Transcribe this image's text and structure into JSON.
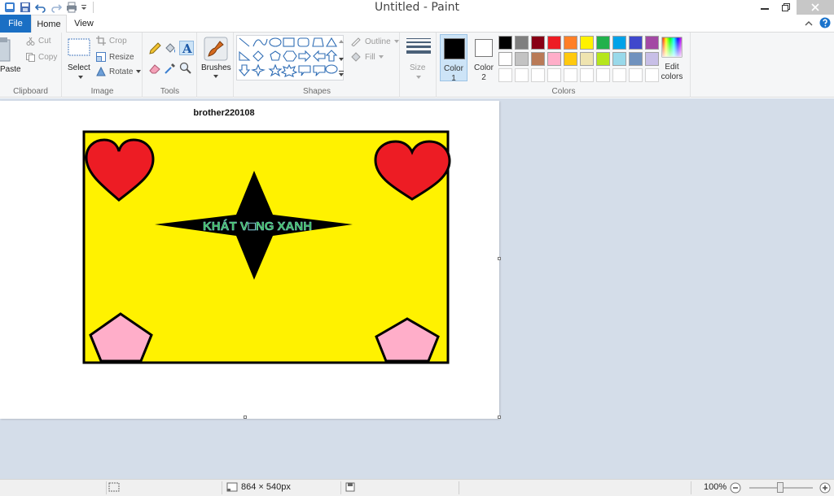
{
  "window": {
    "title": "Untitled - Paint"
  },
  "tabs": {
    "file": "File",
    "home": "Home",
    "view": "View"
  },
  "ribbon": {
    "clipboard": {
      "paste": "Paste",
      "cut": "Cut",
      "copy": "Copy",
      "group_label": "Clipboard"
    },
    "image": {
      "select": "Select",
      "crop": "Crop",
      "resize": "Resize",
      "rotate": "Rotate",
      "group_label": "Image"
    },
    "tools": {
      "group_label": "Tools"
    },
    "brushes": {
      "label": "Brushes"
    },
    "shapes": {
      "outline": "Outline",
      "fill": "Fill",
      "group_label": "Shapes"
    },
    "size": {
      "label": "Size"
    },
    "colors": {
      "color1_label": "Color",
      "color1_num": "1",
      "color2_label": "Color",
      "color2_num": "2",
      "edit_label_1": "Edit",
      "edit_label_2": "colors",
      "group_label": "Colors",
      "color1": "#000000",
      "color2": "#ffffff",
      "palette": [
        "#000000",
        "#7f7f7f",
        "#880015",
        "#ed1c24",
        "#ff7f27",
        "#fff200",
        "#22b14c",
        "#00a2e8",
        "#3f48cc",
        "#a349a4",
        "#ffffff",
        "#c3c3c3",
        "#b97a57",
        "#ffaec9",
        "#ffc90e",
        "#efe4b0",
        "#b5e61d",
        "#99d9ea",
        "#7092be",
        "#c8bfe7"
      ]
    }
  },
  "canvas": {
    "title": "brother220108",
    "banner_text": "KHÁT V□NG XANH",
    "background_color": "#fff200",
    "heart_color": "#ed1c24",
    "pentagon_color": "#ffaec9"
  },
  "statusbar": {
    "dimensions": "864 × 540px",
    "zoom": "100%"
  }
}
